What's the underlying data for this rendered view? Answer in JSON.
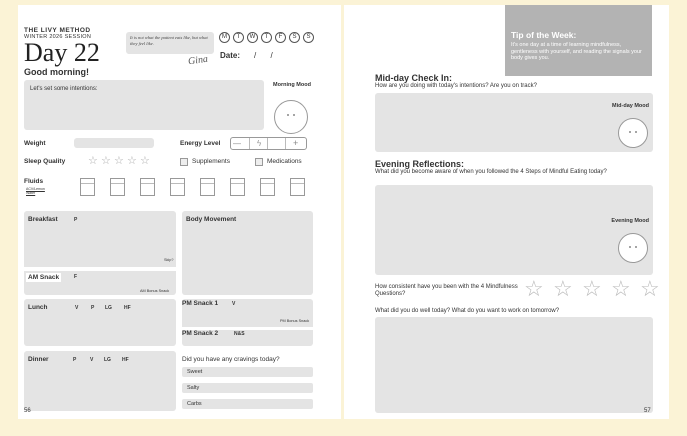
{
  "left": {
    "brand": "THE LIVY METHOD",
    "session": "WINTER 2026 SESSION",
    "day": "Day 22",
    "quote": "It is not what the patient eats like, but what they feel like.",
    "signature": "Gina",
    "weekdays": [
      "M",
      "T",
      "W",
      "T",
      "F",
      "S",
      "S"
    ],
    "date_label": "Date:",
    "date_value": "/     /",
    "greeting": "Good morning!",
    "intentions_label": "Let's set some intentions:",
    "morning_mood": "Morning Mood",
    "weight_label": "Weight",
    "energy_label": "Energy Level",
    "energy_low": "—",
    "energy_high": "+",
    "sleep_label": "Sleep Quality",
    "sleep_stars": 5,
    "supplements_label": "Supplements",
    "medications_label": "Medications",
    "fluids_label": "Fluids",
    "fluids_sublabel": "ACV/Lemon Water",
    "fluids_cups": 8,
    "breakfast_label": "Breakfast",
    "breakfast_icon": "P",
    "skip_label": "Skip?",
    "body_movement_label": "Body Movement",
    "am_snack_label": "AM Snack",
    "am_snack_icon": "F",
    "am_bonus_label": "AM Bonus Snack",
    "lunch_label": "Lunch",
    "lunch_icons": [
      "V",
      "P",
      "LG",
      "HF"
    ],
    "pm_snack1_label": "PM Snack 1",
    "pm_snack1_icon": "V",
    "pm_bonus_label": "PM Bonus Snack",
    "pm_snack2_label": "PM Snack 2",
    "pm_snack2_icon": "N&S",
    "dinner_label": "Dinner",
    "dinner_icons": [
      "P",
      "V",
      "LG",
      "HF"
    ],
    "cravings_label": "Did you have any cravings today?",
    "cravings": [
      "Sweet",
      "Salty",
      "Carbs"
    ],
    "page_number": "56"
  },
  "right": {
    "tip_title": "Tip of the Week:",
    "tip_text": "It's one day at a time of learning mindfulness, gentleness with yourself, and reading the signals your body gives you.",
    "midday_title": "Mid-day Check In:",
    "midday_question": "How are you doing with today's intentions? Are you on track?",
    "midday_mood": "Mid-day Mood",
    "evening_title": "Evening Reflections:",
    "evening_question": "What did you become aware of when you followed the 4 Steps of Mindful Eating today?",
    "evening_mood": "Evening Mood",
    "consistency_question": "How consistent have you been with the 4 Mindfulness Questions?",
    "consistency_stars": 5,
    "welldone_question": "What did you do well today? What do you want to work on tomorrow?",
    "page_number": "57"
  },
  "colors": {
    "background": "#fbf3d6",
    "box": "#e4e4e4",
    "tip_box": "#b3b3b3"
  }
}
